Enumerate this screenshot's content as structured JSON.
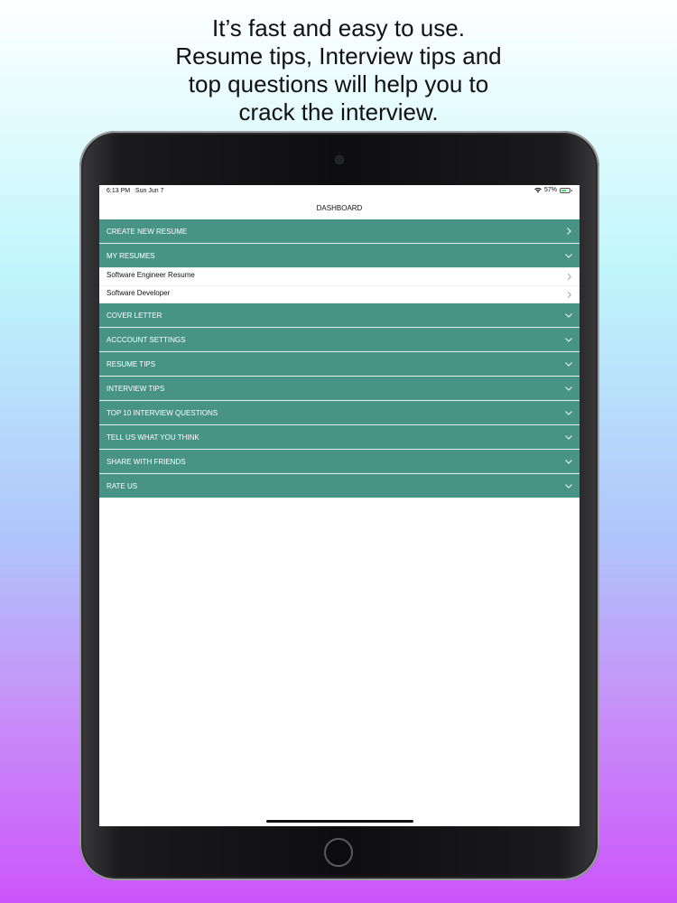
{
  "headline": {
    "line1": "It’s fast and easy to use.",
    "line2": "Resume tips, Interview tips and",
    "line3": "top questions will help you to",
    "line4": "crack the interview."
  },
  "status": {
    "time": "6:13 PM",
    "date": "Sun Jun 7",
    "battery": "57%",
    "battery_level": 0.57
  },
  "nav": {
    "title": "DASHBOARD"
  },
  "menu": {
    "create_new_resume": "CREATE NEW RESUME",
    "my_resumes": "MY RESUMES",
    "resumes": [
      {
        "label": "Software Engineer Resume"
      },
      {
        "label": "Software Developer"
      }
    ],
    "cover_letter": "COVER LETTER",
    "account_settings": "ACCCOUNT SETTINGS",
    "resume_tips": "RESUME TIPS",
    "interview_tips": "INTERVIEW TIPS",
    "top_questions": "TOP 10 INTERVIEW QUESTIONS",
    "feedback": "TELL US WHAT YOU THINK",
    "share": "SHARE WITH FRIENDS",
    "rate": "RATE US"
  },
  "colors": {
    "accent": "#479486",
    "divider": "#e6f1ef"
  },
  "icons": {
    "chevron_right": "chevron-right-icon",
    "chevron_down": "chevron-down-icon",
    "wifi": "wifi-icon",
    "battery": "battery-icon"
  }
}
